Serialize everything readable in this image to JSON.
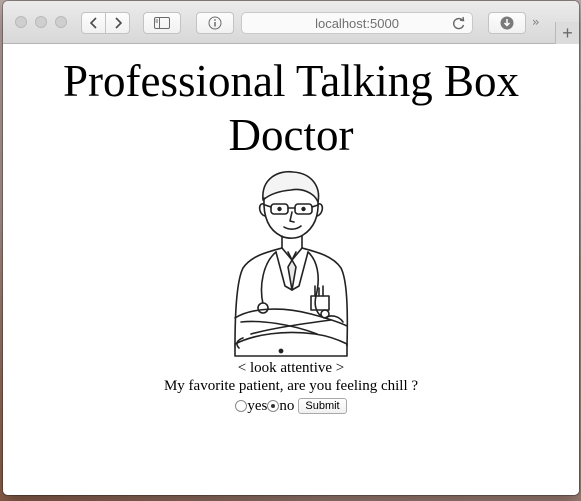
{
  "browser": {
    "address": "localhost:5000",
    "chevrons": "››",
    "new_tab": "+"
  },
  "page": {
    "title": "Professional Talking Box Doctor",
    "image": "doctor-illustration",
    "caption": "< look attentive >",
    "question": "My favorite patient, are you feeling chill ?",
    "options": [
      {
        "label": "yes",
        "checked": false
      },
      {
        "label": "no",
        "checked": true
      }
    ],
    "submit_label": "Submit"
  }
}
